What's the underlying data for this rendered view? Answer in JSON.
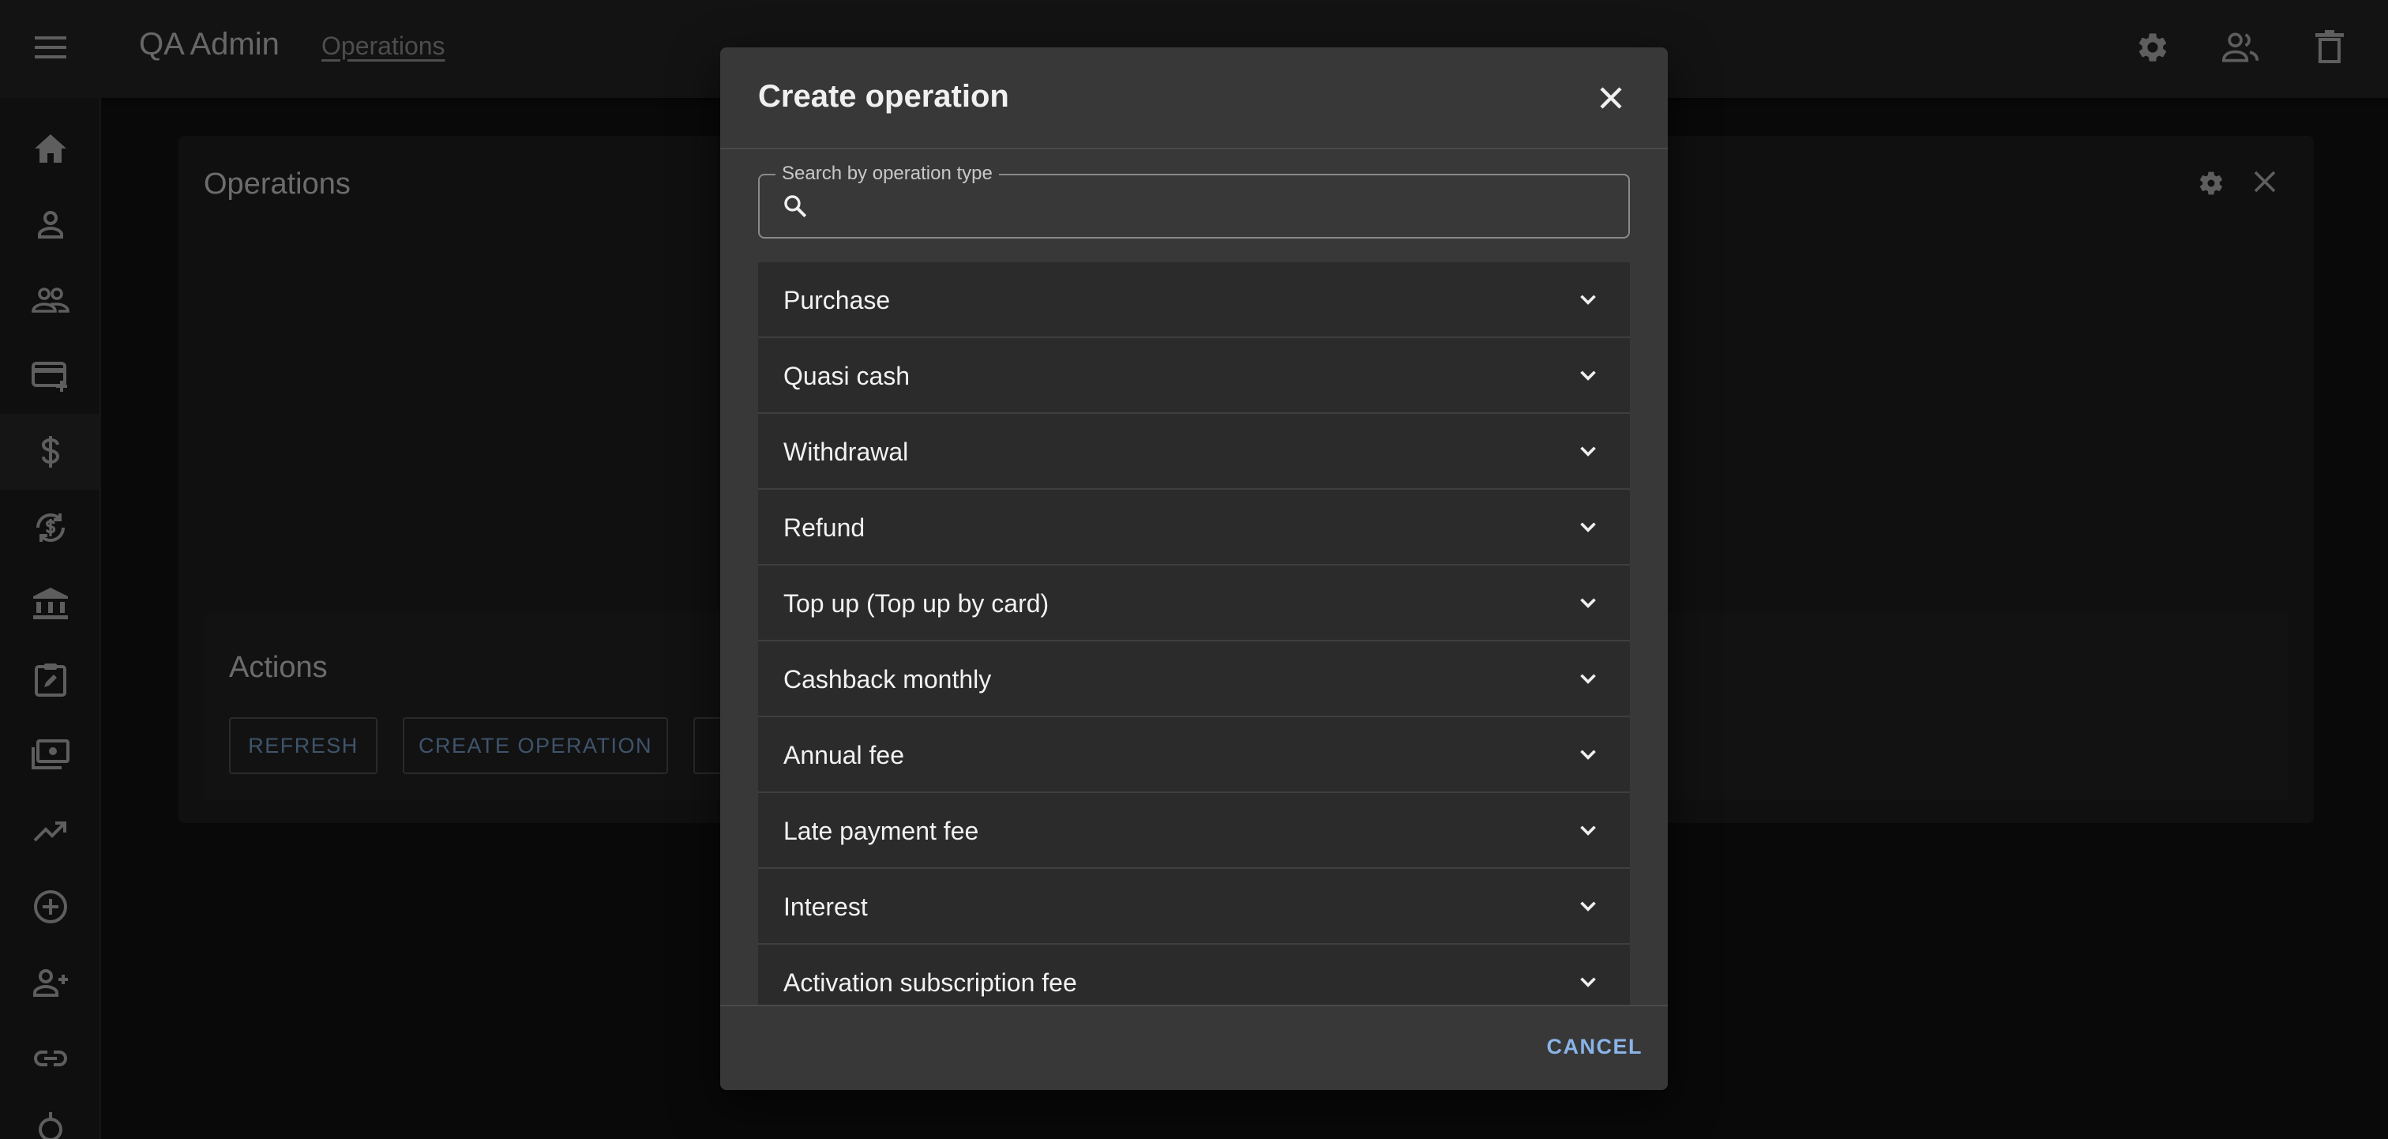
{
  "app": {
    "title": "QA Admin",
    "breadcrumb": "Operations"
  },
  "appbar_icons": [
    "settings-icon",
    "users-icon",
    "delete-icon"
  ],
  "sidebar": {
    "items": [
      {
        "icon": "home-icon"
      },
      {
        "icon": "person-icon"
      },
      {
        "icon": "people-icon"
      },
      {
        "icon": "add-card-icon"
      },
      {
        "icon": "dollar-icon",
        "active": true
      },
      {
        "icon": "currency-exchange-icon"
      },
      {
        "icon": "bank-icon"
      },
      {
        "icon": "assignment-icon"
      },
      {
        "icon": "payments-icon"
      },
      {
        "icon": "trending-up-icon"
      },
      {
        "icon": "add-circle-icon"
      },
      {
        "icon": "person-add-icon"
      },
      {
        "icon": "link-icon"
      },
      {
        "icon": "more-icon"
      }
    ]
  },
  "main": {
    "title": "Operations",
    "actions": {
      "title": "Actions",
      "refresh_label": "REFRESH",
      "create_label": "CREATE OPERATION"
    }
  },
  "dialog": {
    "title": "Create operation",
    "search": {
      "label": "Search by operation type",
      "value": ""
    },
    "operations": [
      "Purchase",
      "Quasi cash",
      "Withdrawal",
      "Refund",
      "Top up (Top up by card)",
      "Cashback monthly",
      "Annual fee",
      "Late payment fee",
      "Interest",
      "Activation subscription fee"
    ],
    "cancel_label": "CANCEL"
  },
  "colors": {
    "accent": "#8ab4e8",
    "surface": "#383838",
    "row": "#2b2b2b",
    "background": "#121212"
  }
}
